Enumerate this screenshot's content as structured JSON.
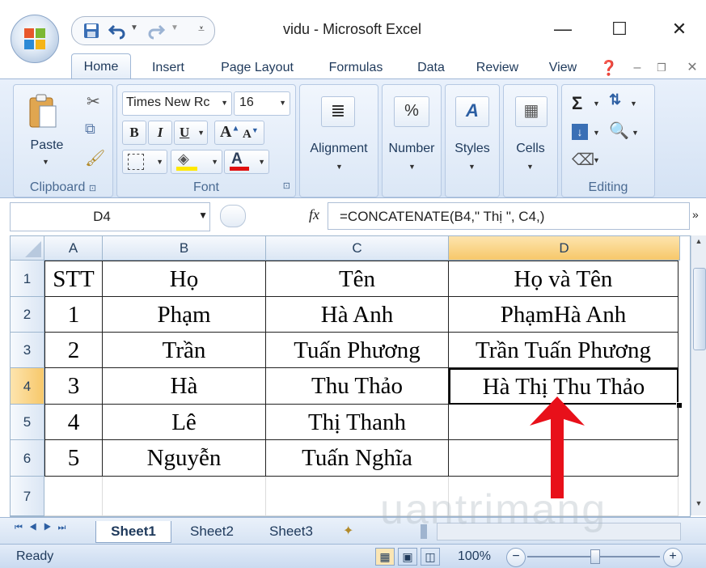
{
  "title": "vidu - Microsoft Excel",
  "window_controls": {
    "minimize": "—",
    "maximize": "☐",
    "close": "✕"
  },
  "tabs": [
    "Home",
    "Insert",
    "Page Layout",
    "Formulas",
    "Data",
    "Review",
    "View"
  ],
  "ribbon": {
    "clipboard": {
      "label": "Clipboard",
      "paste": "Paste"
    },
    "font": {
      "label": "Font",
      "font_name": "Times New Rc",
      "font_size": "16",
      "bold": "B",
      "italic": "I",
      "underline": "U"
    },
    "alignment": "Alignment",
    "number": "Number",
    "styles": "Styles",
    "cells": "Cells",
    "editing": "Editing"
  },
  "formula_bar": {
    "name_box": "D4",
    "fx": "fx",
    "formula": "=CONCATENATE(B4,\" Thị \", C4,)"
  },
  "columns": [
    "A",
    "B",
    "C",
    "D"
  ],
  "rows": [
    {
      "num": "1",
      "cells": [
        "STT",
        "Họ",
        "Tên",
        "Họ và Tên"
      ]
    },
    {
      "num": "2",
      "cells": [
        "1",
        "Phạm",
        "Hà Anh",
        "PhạmHà Anh"
      ]
    },
    {
      "num": "3",
      "cells": [
        "2",
        "Trần",
        "Tuấn Phương",
        "Trần Tuấn Phương"
      ]
    },
    {
      "num": "4",
      "cells": [
        "3",
        "Hà",
        "Thu Thảo",
        "Hà Thị Thu Thảo"
      ]
    },
    {
      "num": "5",
      "cells": [
        "4",
        "Lê",
        "Thị Thanh",
        ""
      ]
    },
    {
      "num": "6",
      "cells": [
        "5",
        "Nguyễn",
        "Tuấn Nghĩa",
        ""
      ]
    },
    {
      "num": "7",
      "cells": [
        "",
        "",
        "",
        ""
      ]
    }
  ],
  "sheets": [
    "Sheet1",
    "Sheet2",
    "Sheet3"
  ],
  "status": {
    "ready": "Ready",
    "zoom": "100%"
  },
  "watermark": "uantrimang",
  "colors": {
    "arrow": "#e8101a",
    "active_col": "#f7c86a",
    "ribbon": "#d4e2f4"
  }
}
